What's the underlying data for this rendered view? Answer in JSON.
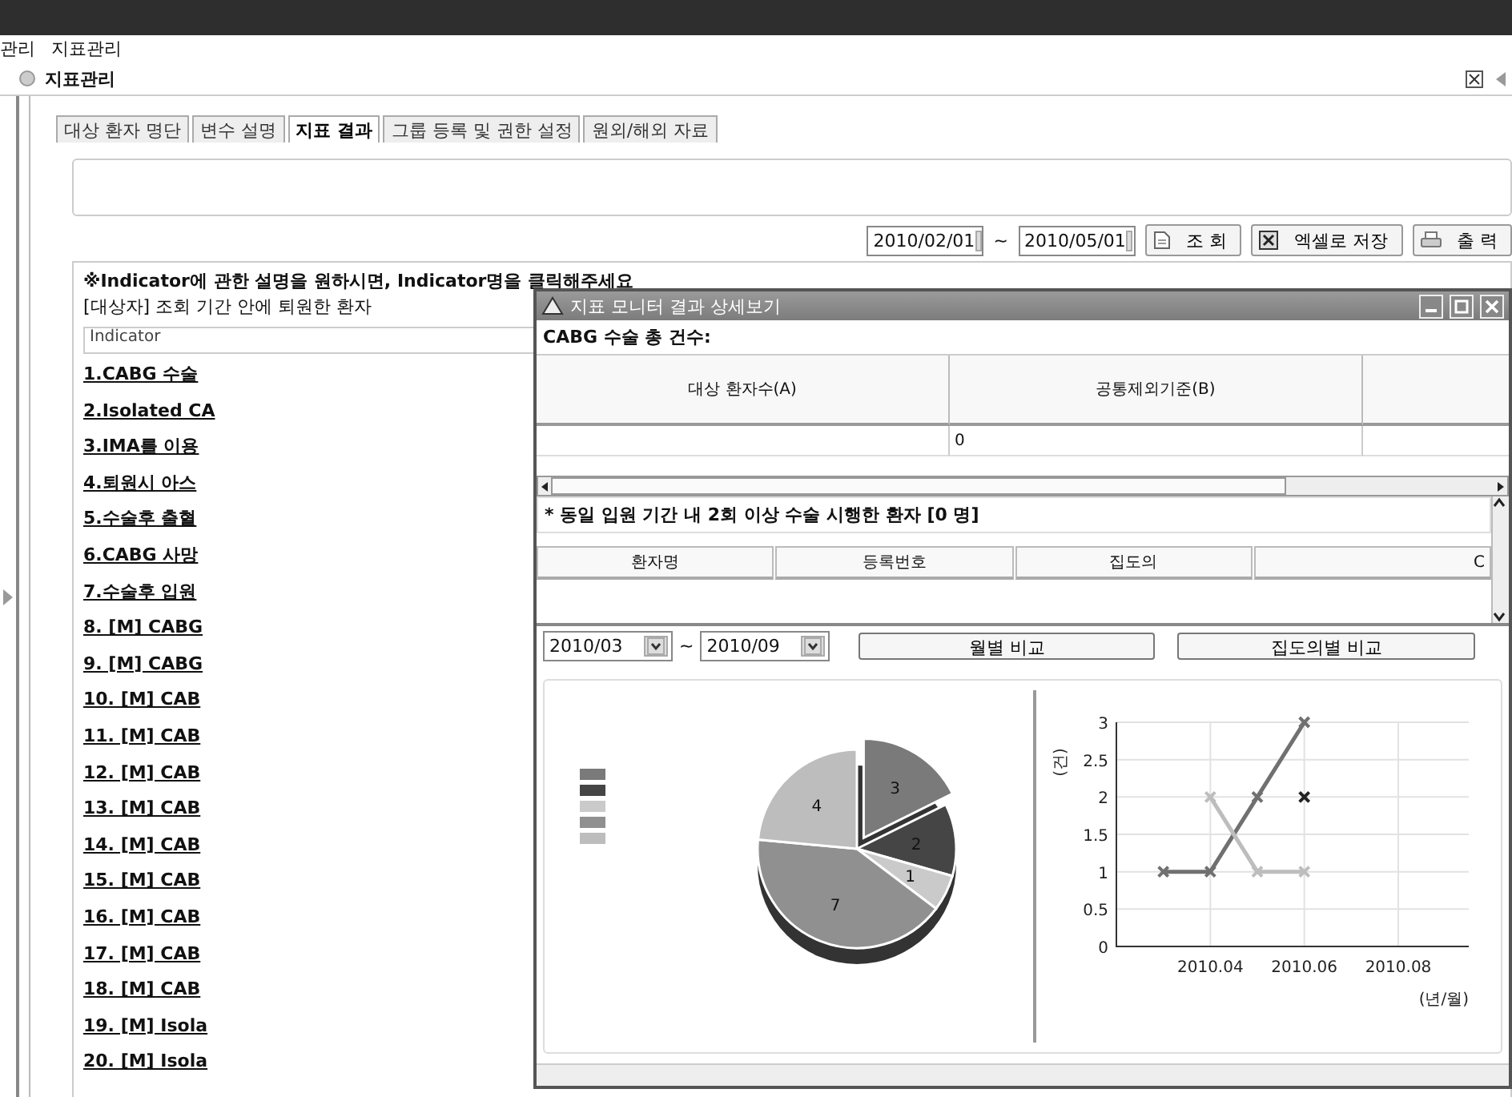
{
  "top_menu": [
    "관리",
    "지표관리"
  ],
  "panel": {
    "title": "지표관리"
  },
  "tabs": [
    {
      "label": "대상 환자 명단",
      "selected": false
    },
    {
      "label": "변수 설명",
      "selected": false
    },
    {
      "label": "지표 결과",
      "selected": true
    },
    {
      "label": "그룹 등록 및 권한 설정",
      "selected": false
    },
    {
      "label": "원외/해외 자료",
      "selected": false
    }
  ],
  "filter": {
    "start_date": "2010/02/01",
    "separator": "~",
    "end_date": "2010/05/01",
    "buttons": [
      {
        "label": "조 회",
        "kind": "search"
      },
      {
        "label": "엑셀로 저장",
        "kind": "excel"
      },
      {
        "label": "출 력",
        "kind": "print"
      }
    ]
  },
  "notes": [
    "※Indicator에 관한 설명을 원하시면, Indicator명을 클릭해주세요",
    "[대상자] 조회 기간 안에 퇴원한 환자"
  ],
  "indicator_header": "Indicator",
  "indicators": [
    "1.CABG 수술",
    "2.Isolated CA",
    "3.IMA를 이용",
    "4.퇴원시 아스",
    "5.수술후 출혈",
    "6.CABG 사망",
    "7.수술후 입원",
    "8. [M] CABG",
    "9. [M] CABG",
    "10. [M] CAB",
    "11. [M] CAB",
    "12. [M] CAB",
    "13. [M] CAB",
    "14. [M] CAB",
    "15. [M] CAB",
    "16. [M] CAB",
    "17. [M] CAB",
    "18. [M] CAB",
    "19. [M] Isola",
    "20. [M] Isola"
  ],
  "detail_window": {
    "title": "지표 모니터 결과 상세보기",
    "total_label": "CABG 수술 총 건수:",
    "summary_columns": [
      "대상 환자수(A)",
      "공통제외기준(B)"
    ],
    "summary_b_value": "0",
    "repeat_label": "* 동일 입원 기간 내 2회 이상 수술 시행한 환자 [0 명]",
    "patient_columns": [
      "환자명",
      "등록번호",
      "집도의",
      "C"
    ],
    "period_from": "2010/03",
    "period_separator": "~",
    "period_to": "2010/09",
    "compare_buttons": [
      "월별 비교",
      "집도의별 비교"
    ],
    "pie": {
      "chart_data": {
        "type": "pie",
        "values": [
          3,
          2,
          1,
          7,
          4
        ],
        "data_labels": true
      }
    },
    "line": {
      "chart_data": {
        "type": "line",
        "xlabel": "(년/월)",
        "ylabel": "(건)",
        "categories": [
          null,
          null,
          "2010.04",
          null,
          "2010.06",
          null,
          "2010.08",
          null
        ],
        "grid": true,
        "series": [
          {
            "color": "#707070",
            "marker": "x",
            "values": [
              null,
              1,
              1,
              2,
              3,
              null,
              null,
              null
            ]
          },
          {
            "color": "#bdbdbd",
            "marker": "x",
            "values": [
              null,
              null,
              2,
              1,
              1,
              null,
              null,
              null
            ]
          },
          {
            "color": "#222222",
            "marker": "x",
            "values": [
              null,
              null,
              null,
              null,
              2,
              null,
              null,
              null
            ]
          }
        ],
        "ylim": [
          0,
          3
        ],
        "yticks": [
          0,
          0.5,
          1,
          1.5,
          2,
          2.5,
          3
        ]
      }
    }
  }
}
